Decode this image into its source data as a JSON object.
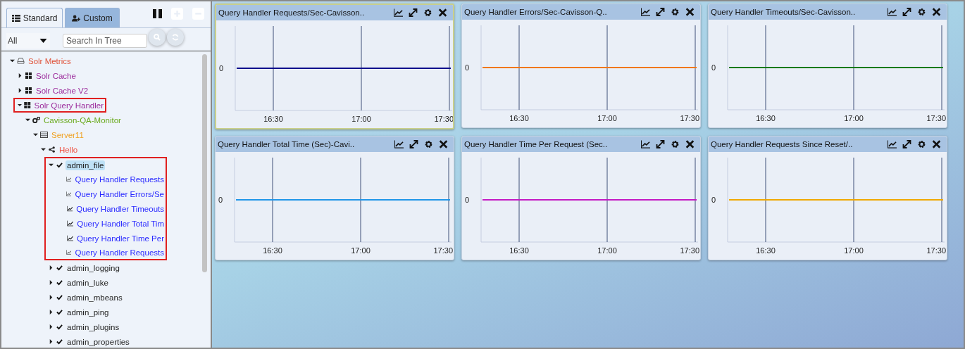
{
  "tabs": [
    {
      "label": "Standard",
      "selected": true
    },
    {
      "label": "Custom",
      "selected": false
    }
  ],
  "filter": {
    "value": "All"
  },
  "search": {
    "placeholder": "Search In Tree"
  },
  "tree": [
    {
      "label": "Solr Metrics",
      "kind": "drive",
      "color": "#e0533a",
      "expanded": true,
      "selected": false,
      "highlighted": false,
      "children": [
        {
          "label": "Solr Cache",
          "kind": "group",
          "color": "#9b2a9b",
          "expanded": false,
          "selected": false,
          "highlighted": false
        },
        {
          "label": "Solr Cache V2",
          "kind": "group",
          "color": "#9b2a9b",
          "expanded": false,
          "selected": false,
          "highlighted": false
        },
        {
          "label": "Solr Query Handler",
          "kind": "group",
          "color": "#9b2a9b",
          "expanded": true,
          "selected": false,
          "highlighted": true,
          "children": [
            {
              "label": "Cavisson-QA-Monitor",
              "kind": "tier",
              "color": "#6aaa1e",
              "expanded": true,
              "selected": false,
              "highlighted": false,
              "children": [
                {
                  "label": "Server11",
                  "kind": "server",
                  "color": "#f0a020",
                  "expanded": true,
                  "selected": false,
                  "highlighted": false,
                  "children": [
                    {
                      "label": "Hello",
                      "kind": "instance",
                      "color": "#f05040",
                      "expanded": true,
                      "selected": false,
                      "highlighted": false,
                      "children": [
                        {
                          "label": "admin_file",
                          "kind": "handler",
                          "color": "#222222",
                          "expanded": true,
                          "selected": true,
                          "highlighted": true,
                          "children": [
                            {
                              "label": "Query Handler Requests",
                              "kind": "metric",
                              "color": "#2a2aff",
                              "selected": false,
                              "highlighted": false
                            },
                            {
                              "label": "Query Handler Errors/Se",
                              "kind": "metric",
                              "color": "#2a2aff",
                              "selected": false,
                              "highlighted": false
                            },
                            {
                              "label": "Query Handler Timeouts",
                              "kind": "metric",
                              "color": "#2a2aff",
                              "selected": false,
                              "highlighted": false
                            },
                            {
                              "label": "Query Handler Total Tim",
                              "kind": "metric",
                              "color": "#2a2aff",
                              "selected": false,
                              "highlighted": false
                            },
                            {
                              "label": "Query Handler Time Per",
                              "kind": "metric",
                              "color": "#2a2aff",
                              "selected": false,
                              "highlighted": false
                            },
                            {
                              "label": "Query Handler Requests",
                              "kind": "metric",
                              "color": "#2a2aff",
                              "selected": false,
                              "highlighted": false
                            }
                          ]
                        },
                        {
                          "label": "admin_logging",
                          "kind": "handler",
                          "color": "#222222",
                          "expanded": false,
                          "selected": false,
                          "highlighted": false
                        },
                        {
                          "label": "admin_luke",
                          "kind": "handler",
                          "color": "#222222",
                          "expanded": false,
                          "selected": false,
                          "highlighted": false
                        },
                        {
                          "label": "admin_mbeans",
                          "kind": "handler",
                          "color": "#222222",
                          "expanded": false,
                          "selected": false,
                          "highlighted": false
                        },
                        {
                          "label": "admin_ping",
                          "kind": "handler",
                          "color": "#222222",
                          "expanded": false,
                          "selected": false,
                          "highlighted": false
                        },
                        {
                          "label": "admin_plugins",
                          "kind": "handler",
                          "color": "#222222",
                          "expanded": false,
                          "selected": false,
                          "highlighted": false
                        },
                        {
                          "label": "admin_properties",
                          "kind": "handler",
                          "color": "#222222",
                          "expanded": false,
                          "selected": false,
                          "highlighted": false
                        }
                      ]
                    }
                  ]
                }
              ]
            }
          ]
        }
      ]
    }
  ],
  "panels": [
    {
      "title": "Query Handler Requests/Sec-Cavisson..",
      "selected": true,
      "color": "#0d0d8c",
      "y_label": "0",
      "x_labels": [
        "16:30",
        "17:00",
        "17:30"
      ]
    },
    {
      "title": "Query Handler Errors/Sec-Cavisson-Q..",
      "selected": false,
      "color": "#f07818",
      "y_label": "0",
      "x_labels": [
        "16:30",
        "17:00",
        "17:30"
      ]
    },
    {
      "title": "Query Handler Timeouts/Sec-Cavisson..",
      "selected": false,
      "color": "#137a13",
      "y_label": "0",
      "x_labels": [
        "16:30",
        "17:00",
        "17:30"
      ]
    },
    {
      "title": "Query Handler Total Time (Sec)-Cavi..",
      "selected": false,
      "color": "#2196e8",
      "y_label": "0",
      "x_labels": [
        "16:30",
        "17:00",
        "17:30"
      ]
    },
    {
      "title": "Query Handler Time Per Request (Sec..",
      "selected": false,
      "color": "#c41ac4",
      "y_label": "0",
      "x_labels": [
        "16:30",
        "17:00",
        "17:30"
      ]
    },
    {
      "title": "Query Handler Requests Since Reset/..",
      "selected": false,
      "color": "#f0a800",
      "y_label": "0",
      "x_labels": [
        "16:30",
        "17:00",
        "17:30"
      ]
    }
  ]
}
